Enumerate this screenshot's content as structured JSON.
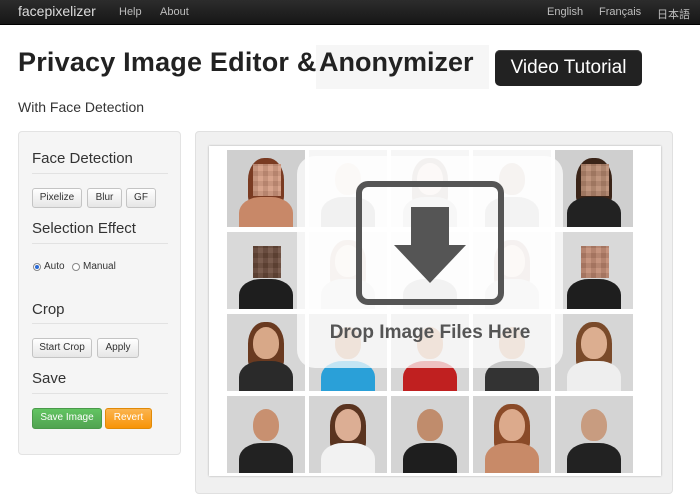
{
  "nav": {
    "brand": "facepixelizer",
    "links": [
      "Help",
      "About"
    ],
    "languages": [
      "English",
      "Français",
      "日本語"
    ]
  },
  "header": {
    "title_part1": "Privacy Image Editor &",
    "title_part2": "Anonymizer",
    "video_button": "Video Tutorial",
    "subtitle": "With Face Detection"
  },
  "sidebar": {
    "face_detection": {
      "title": "Face Detection",
      "buttons": [
        "Pixelize",
        "Blur",
        "GF"
      ]
    },
    "selection_effect": {
      "title": "Selection Effect",
      "options": [
        "Auto",
        "Manual"
      ],
      "selected": "Auto"
    },
    "crop": {
      "title": "Crop",
      "buttons": [
        "Start Crop",
        "Apply"
      ]
    },
    "save": {
      "title": "Save",
      "save_button": "Save Image",
      "revert_button": "Revert"
    }
  },
  "dropzone": {
    "text": "Drop Image Files Here",
    "icon": "download-arrow-icon"
  },
  "colors": {
    "navbar": "#1b1b1b",
    "save": "#51a351",
    "revert": "#f89406",
    "video_button": "#222222"
  }
}
